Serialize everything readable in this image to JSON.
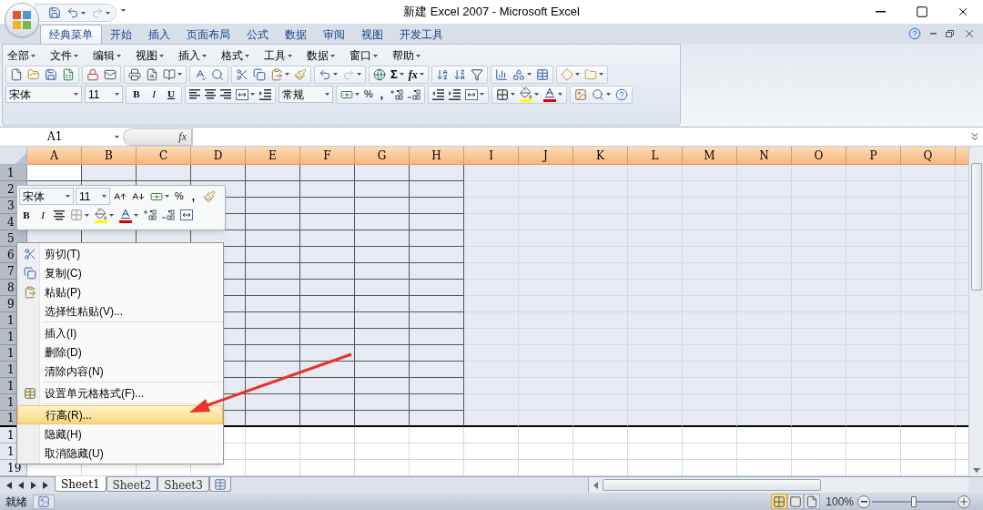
{
  "window": {
    "title": "新建 Excel 2007 - Microsoft Excel"
  },
  "ribbon_tabs": [
    {
      "label": "经典菜单",
      "selected": true
    },
    {
      "label": "开始",
      "selected": false
    },
    {
      "label": "插入",
      "selected": false
    },
    {
      "label": "页面布局",
      "selected": false
    },
    {
      "label": "公式",
      "selected": false
    },
    {
      "label": "数据",
      "selected": false
    },
    {
      "label": "审阅",
      "selected": false
    },
    {
      "label": "视图",
      "selected": false
    },
    {
      "label": "开发工具",
      "selected": false
    }
  ],
  "menu_bar": [
    "全部",
    "文件",
    "编辑",
    "视图",
    "插入",
    "格式",
    "工具",
    "数据",
    "窗口",
    "帮助"
  ],
  "toolbar": {
    "sum": "Σ",
    "function": "fx",
    "font": "宋体",
    "font_size": "11",
    "bold": "B",
    "italic": "I",
    "underline": "U",
    "number_format": "常规",
    "percent": "%",
    "comma": ","
  },
  "formula_bar": {
    "name_box": "A1",
    "fx": "fx"
  },
  "columns": [
    {
      "label": "A",
      "bordered": true,
      "active": true
    },
    {
      "label": "B",
      "bordered": true
    },
    {
      "label": "C",
      "bordered": true
    },
    {
      "label": "D",
      "bordered": true
    },
    {
      "label": "E",
      "bordered": true
    },
    {
      "label": "F",
      "bordered": true
    },
    {
      "label": "G",
      "bordered": true
    },
    {
      "label": "H",
      "bordered": true
    },
    {
      "label": "I",
      "bordered": false
    },
    {
      "label": "J",
      "bordered": false
    },
    {
      "label": "K",
      "bordered": false
    },
    {
      "label": "L",
      "bordered": false
    },
    {
      "label": "M",
      "bordered": false
    },
    {
      "label": "N",
      "bordered": false
    },
    {
      "label": "O",
      "bordered": false
    },
    {
      "label": "P",
      "bordered": false
    },
    {
      "label": "Q",
      "bordered": false
    }
  ],
  "rows": [
    {
      "label": "1",
      "selected": true,
      "bordered": true,
      "active": true
    },
    {
      "label": "2",
      "selected": true,
      "bordered": true
    },
    {
      "label": "3",
      "selected": true,
      "bordered": true
    },
    {
      "label": "4",
      "selected": true,
      "bordered": true
    },
    {
      "label": "5",
      "selected": true,
      "bordered": true
    },
    {
      "label": "6",
      "selected": true,
      "bordered": true
    },
    {
      "label": "7",
      "selected": true,
      "bordered": true
    },
    {
      "label": "8",
      "selected": true,
      "bordered": true
    },
    {
      "label": "9",
      "selected": true,
      "bordered": true
    },
    {
      "label": "1",
      "selected": true,
      "bordered": true
    },
    {
      "label": "1",
      "selected": true,
      "bordered": true
    },
    {
      "label": "1",
      "selected": true,
      "bordered": true
    },
    {
      "label": "1",
      "selected": true,
      "bordered": true
    },
    {
      "label": "1",
      "selected": true,
      "bordered": true
    },
    {
      "label": "1",
      "selected": true,
      "bordered": true
    },
    {
      "label": "1",
      "selected": true,
      "bordered": true
    },
    {
      "label": "1",
      "selected": false,
      "bordered": false
    },
    {
      "label": "1",
      "selected": false,
      "bordered": false
    },
    {
      "label": "19",
      "selected": false,
      "bordered": false
    }
  ],
  "mini_toolbar": {
    "font": "宋体",
    "font_size": "11",
    "percent": "%",
    "comma": ",",
    "bold": "B",
    "italic": "I"
  },
  "context_menu": {
    "groups": [
      [
        {
          "label": "剪切(T)",
          "kind": "cut",
          "selected": false
        },
        {
          "label": "复制(C)",
          "kind": "copy",
          "selected": false
        },
        {
          "label": "粘贴(P)",
          "kind": "paste",
          "selected": false
        },
        {
          "label": "选择性粘贴(V)...",
          "kind": "text",
          "selected": false
        }
      ],
      [
        {
          "label": "插入(I)",
          "kind": "text",
          "selected": false
        },
        {
          "label": "删除(D)",
          "kind": "text",
          "selected": false
        },
        {
          "label": "清除内容(N)",
          "kind": "text",
          "selected": false
        }
      ],
      [
        {
          "label": "设置单元格格式(F)...",
          "kind": "format",
          "selected": false
        }
      ],
      [
        {
          "label": "行高(R)...",
          "kind": "text",
          "selected": true
        },
        {
          "label": "隐藏(H)",
          "kind": "text",
          "selected": false
        },
        {
          "label": "取消隐藏(U)",
          "kind": "text",
          "selected": false
        }
      ]
    ]
  },
  "sheet_tabs": [
    {
      "label": "Sheet1",
      "selected": true
    },
    {
      "label": "Sheet2",
      "selected": false
    },
    {
      "label": "Sheet3",
      "selected": false
    }
  ],
  "status_bar": {
    "status": "就绪",
    "view_buttons": [
      {
        "kind": "normal",
        "selected": true
      },
      {
        "kind": "layout",
        "selected": false
      },
      {
        "kind": "pagebreak",
        "selected": false
      }
    ],
    "zoom": "100%",
    "zoom_slider": {
      "level": 0.5
    }
  }
}
